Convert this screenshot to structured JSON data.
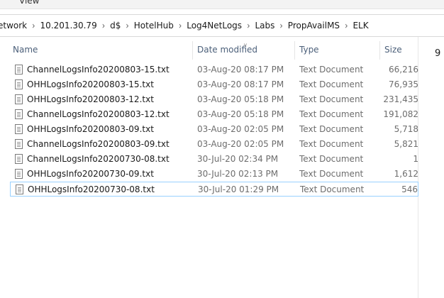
{
  "ribbon": {
    "tab_label": "View"
  },
  "address": {
    "crumbs": [
      "etwork",
      "10.201.30.79",
      "d$",
      "HotelHub",
      "Log4NetLogs",
      "Labs",
      "PropAvailMS",
      "ELK"
    ]
  },
  "columns": {
    "name": "Name",
    "date": "Date modified",
    "type": "Type",
    "size": "Size"
  },
  "side_value": "9",
  "files": [
    {
      "name": "ChannelLogsInfo20200803-15.txt",
      "date": "03-Aug-20 08:17 PM",
      "type": "Text Document",
      "size": "66,216"
    },
    {
      "name": "OHHLogsInfo20200803-15.txt",
      "date": "03-Aug-20 08:17 PM",
      "type": "Text Document",
      "size": "76,935"
    },
    {
      "name": "OHHLogsInfo20200803-12.txt",
      "date": "03-Aug-20 05:18 PM",
      "type": "Text Document",
      "size": "231,435"
    },
    {
      "name": "ChannelLogsInfo20200803-12.txt",
      "date": "03-Aug-20 05:18 PM",
      "type": "Text Document",
      "size": "191,082"
    },
    {
      "name": "OHHLogsInfo20200803-09.txt",
      "date": "03-Aug-20 02:05 PM",
      "type": "Text Document",
      "size": "5,718"
    },
    {
      "name": "ChannelLogsInfo20200803-09.txt",
      "date": "03-Aug-20 02:05 PM",
      "type": "Text Document",
      "size": "5,821"
    },
    {
      "name": "ChannelLogsInfo20200730-08.txt",
      "date": "30-Jul-20 02:34 PM",
      "type": "Text Document",
      "size": "1"
    },
    {
      "name": "OHHLogsInfo20200730-09.txt",
      "date": "30-Jul-20 02:13 PM",
      "type": "Text Document",
      "size": "1,612"
    },
    {
      "name": "OHHLogsInfo20200730-08.txt",
      "date": "30-Jul-20 01:29 PM",
      "type": "Text Document",
      "size": "546"
    }
  ],
  "selected_index": 8
}
